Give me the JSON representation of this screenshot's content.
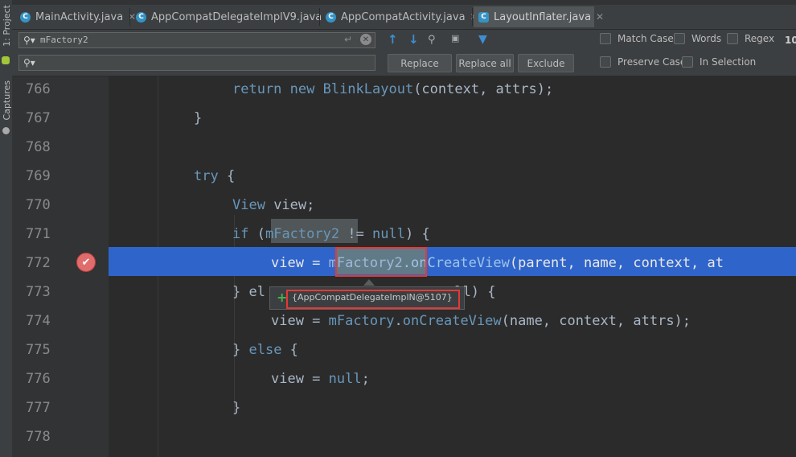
{
  "side_panel": {
    "project_label": "1: Project",
    "captures_label": "Captures"
  },
  "tabs": [
    {
      "label": "MainActivity.java",
      "icon": "C",
      "active": false
    },
    {
      "label": "AppCompatDelegateImplV9.java",
      "icon": "C",
      "active": false
    },
    {
      "label": "AppCompatActivity.java",
      "icon": "C",
      "active": false
    },
    {
      "label": "LayoutInflater.java",
      "icon": "C",
      "active": true
    }
  ],
  "find": {
    "search_value": "mFactory2",
    "replace_value": "",
    "replace_label": "Replace",
    "replace_all_label": "Replace all",
    "exclude_label": "Exclude",
    "match_case_label": "Match Case",
    "words_label": "Words",
    "regex_label": "Regex",
    "preserve_case_label": "Preserve Case",
    "in_selection_label": "In Selection",
    "result_count": "10"
  },
  "editor": {
    "lines": [
      {
        "num": "766",
        "code": "return new BlinkLayout(context, attrs);"
      },
      {
        "num": "767",
        "code": "}"
      },
      {
        "num": "768",
        "code": ""
      },
      {
        "num": "769",
        "code": "try {"
      },
      {
        "num": "770",
        "code": "View view;"
      },
      {
        "num": "771",
        "code": "if (mFactory2 != null) {"
      },
      {
        "num": "772",
        "code": "view = mFactory2.onCreateView(parent, name, context, at"
      },
      {
        "num": "773",
        "code": "} else if (mFactory != null) {"
      },
      {
        "num": "774",
        "code": "view = mFactory.onCreateView(name, context, attrs);"
      },
      {
        "num": "775",
        "code": "} else {"
      },
      {
        "num": "776",
        "code": "view = null;"
      },
      {
        "num": "777",
        "code": "}"
      },
      {
        "num": "778",
        "code": ""
      }
    ],
    "debug_popup": "{AppCompatDelegateImplN@5107}"
  },
  "colors": {
    "highlight_row": "#2f65ca",
    "red_box": "#e53935",
    "keyword": "#cc7832",
    "field": "#9876aa",
    "method": "#ffc66d"
  }
}
